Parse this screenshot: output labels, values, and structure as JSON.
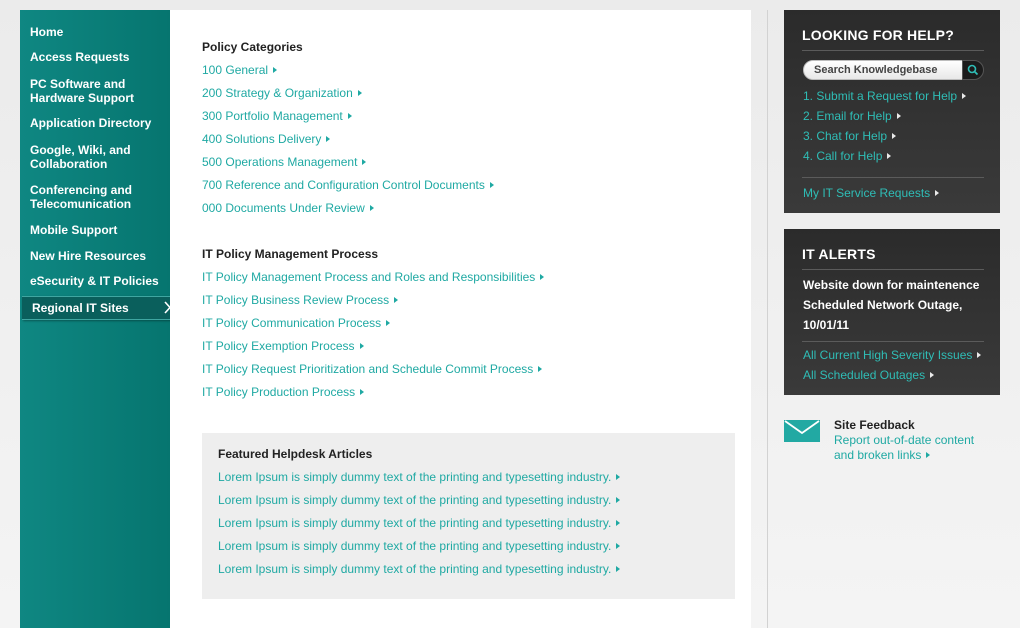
{
  "nav": {
    "items": [
      {
        "label": "Home"
      },
      {
        "label": "Access Requests"
      },
      {
        "label": "PC Software and\nHardware Support"
      },
      {
        "label": "Application Directory"
      },
      {
        "label": "Google, Wiki, and\nCollaboration"
      },
      {
        "label": "Conferencing and\nTelecomunication"
      },
      {
        "label": "Mobile Support"
      },
      {
        "label": "New Hire Resources"
      },
      {
        "label": "eSecurity & IT Policies"
      },
      {
        "label": "Regional IT Sites",
        "active": true
      }
    ]
  },
  "policy_categories": {
    "title": "Policy Categories",
    "links": [
      "100 General",
      "200 Strategy & Organization",
      "300 Portfolio Management",
      "400 Solutions Delivery",
      "500 Operations Management",
      "700 Reference and Configuration Control Documents",
      "000 Documents Under Review"
    ]
  },
  "policy_process": {
    "title": "IT Policy Management Process",
    "links": [
      "IT Policy Management Process and Roles and Responsibilities",
      "IT Policy Business Review Process",
      "IT Policy Communication Process",
      "IT Policy Exemption Process",
      "IT Policy Request Prioritization and Schedule Commit Process",
      "IT Policy Production Process"
    ]
  },
  "featured": {
    "title": "Featured Helpdesk Articles",
    "links": [
      "Lorem Ipsum is simply dummy text of the printing and typesetting industry.",
      "Lorem Ipsum is simply dummy text of the printing and typesetting industry.",
      "Lorem Ipsum is simply dummy text of the printing and typesetting industry.",
      "Lorem Ipsum is simply dummy text of the printing and typesetting industry.",
      "Lorem Ipsum is simply dummy text of the printing and typesetting industry."
    ]
  },
  "help": {
    "title": "LOOKING FOR HELP?",
    "search_placeholder": "Search Knowledgebase",
    "links": [
      "1. Submit a Request for Help",
      "2. Email for Help",
      "3. Chat for Help",
      "4. Call for Help"
    ],
    "service_requests": "My IT Service Requests"
  },
  "alerts": {
    "title": "IT ALERTS",
    "messages": [
      "Website down for maintenence",
      "Scheduled Network Outage,",
      "10/01/11"
    ],
    "links": [
      "All Current High Severity Issues",
      "All Scheduled Outages"
    ]
  },
  "feedback": {
    "title": "Site Feedback",
    "line1": "Report out-of-date content",
    "line2": "and broken links"
  },
  "colors": {
    "teal": "#0f8782",
    "link": "#1fa9a3",
    "dark_panel": "#333333"
  }
}
